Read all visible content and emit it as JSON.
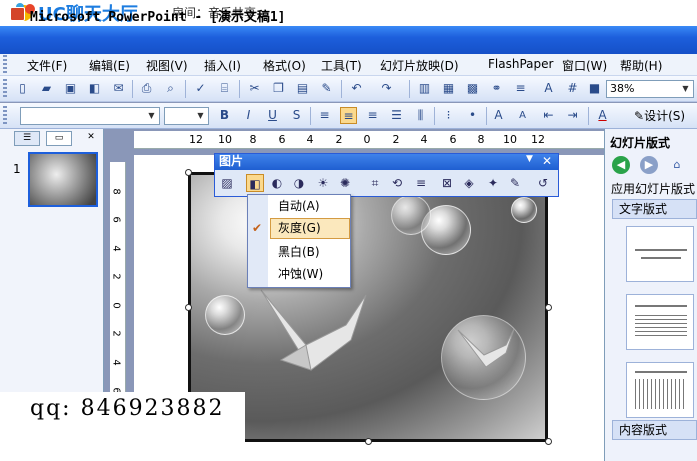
{
  "uc_bar": {
    "logo_text": "UC聊天大厅",
    "room_label": "房间：音乐共享"
  },
  "window": {
    "title": "Microsoft PowerPoint - [演示文稿1]"
  },
  "menu": {
    "items": [
      "文件(F)",
      "编辑(E)",
      "视图(V)",
      "插入(I)",
      "格式(O)",
      "工具(T)",
      "幻灯片放映(D)",
      "FlashPaper",
      "窗口(W)",
      "帮助(H)"
    ]
  },
  "toolbar": {
    "zoom": "38%",
    "design_label": "设计(S)"
  },
  "slides_pane": {
    "slide_number": "1"
  },
  "ruler": {
    "h_labels": [
      "12",
      "10",
      "8",
      "6",
      "4",
      "2",
      "0",
      "2",
      "4",
      "6",
      "8",
      "10",
      "12"
    ],
    "v_labels": [
      "8",
      "6",
      "4",
      "2",
      "0",
      "2",
      "4",
      "6"
    ]
  },
  "picture_toolbar": {
    "title": "图片"
  },
  "color_menu": {
    "items": [
      {
        "label": "自动(A)",
        "checked": false
      },
      {
        "label": "灰度(G)",
        "checked": true
      },
      {
        "label": "黑白(B)",
        "checked": false
      },
      {
        "label": "冲蚀(W)",
        "checked": false
      }
    ]
  },
  "task_pane": {
    "title": "幻灯片版式",
    "apply_label": "应用幻灯片版式",
    "section_text": "文字版式",
    "section_content": "内容版式"
  },
  "watermark": {
    "qq": "qq: 846923882"
  }
}
